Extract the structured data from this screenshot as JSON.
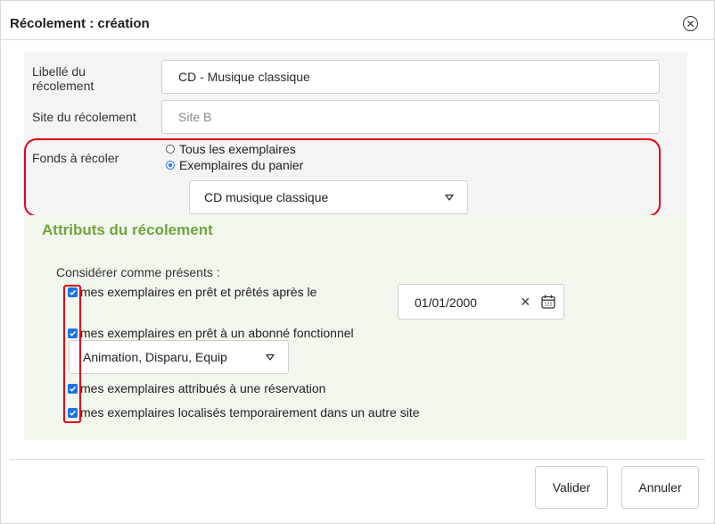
{
  "dialog": {
    "title": "Récolement : création",
    "close_icon": "close-circle-icon"
  },
  "form": {
    "libelle_label": "Libellé du récolement",
    "libelle_value": "CD - Musique classique",
    "site_label": "Site du récolement",
    "site_placeholder": "Site B",
    "fonds_label": "Fonds à récoler",
    "fonds_options": [
      {
        "label": "Tous les exemplaires",
        "checked": false
      },
      {
        "label": "Exemplaires du panier",
        "checked": true
      }
    ],
    "panier_select_value": "CD musique classique"
  },
  "attributes": {
    "section_title": "Attributs du récolement",
    "subtitle": "Considérer comme présents :",
    "checks": [
      {
        "label": "mes exemplaires en prêt et prêtés après le",
        "checked": true
      },
      {
        "label": "mes exemplaires en prêt à un abonné fonctionnel",
        "checked": true
      },
      {
        "label": "mes exemplaires attribués à une réservation",
        "checked": true
      },
      {
        "label": "mes exemplaires localisés temporairement dans un autre site",
        "checked": true
      }
    ],
    "date_value": "01/01/2000",
    "abonne_select_value": "Animation, Disparu, Equip"
  },
  "footer": {
    "validate_label": "Valider",
    "cancel_label": "Annuler"
  },
  "colors": {
    "accent": "#1a73e8",
    "section_title": "#72a33f",
    "highlight": "#e3001b"
  }
}
